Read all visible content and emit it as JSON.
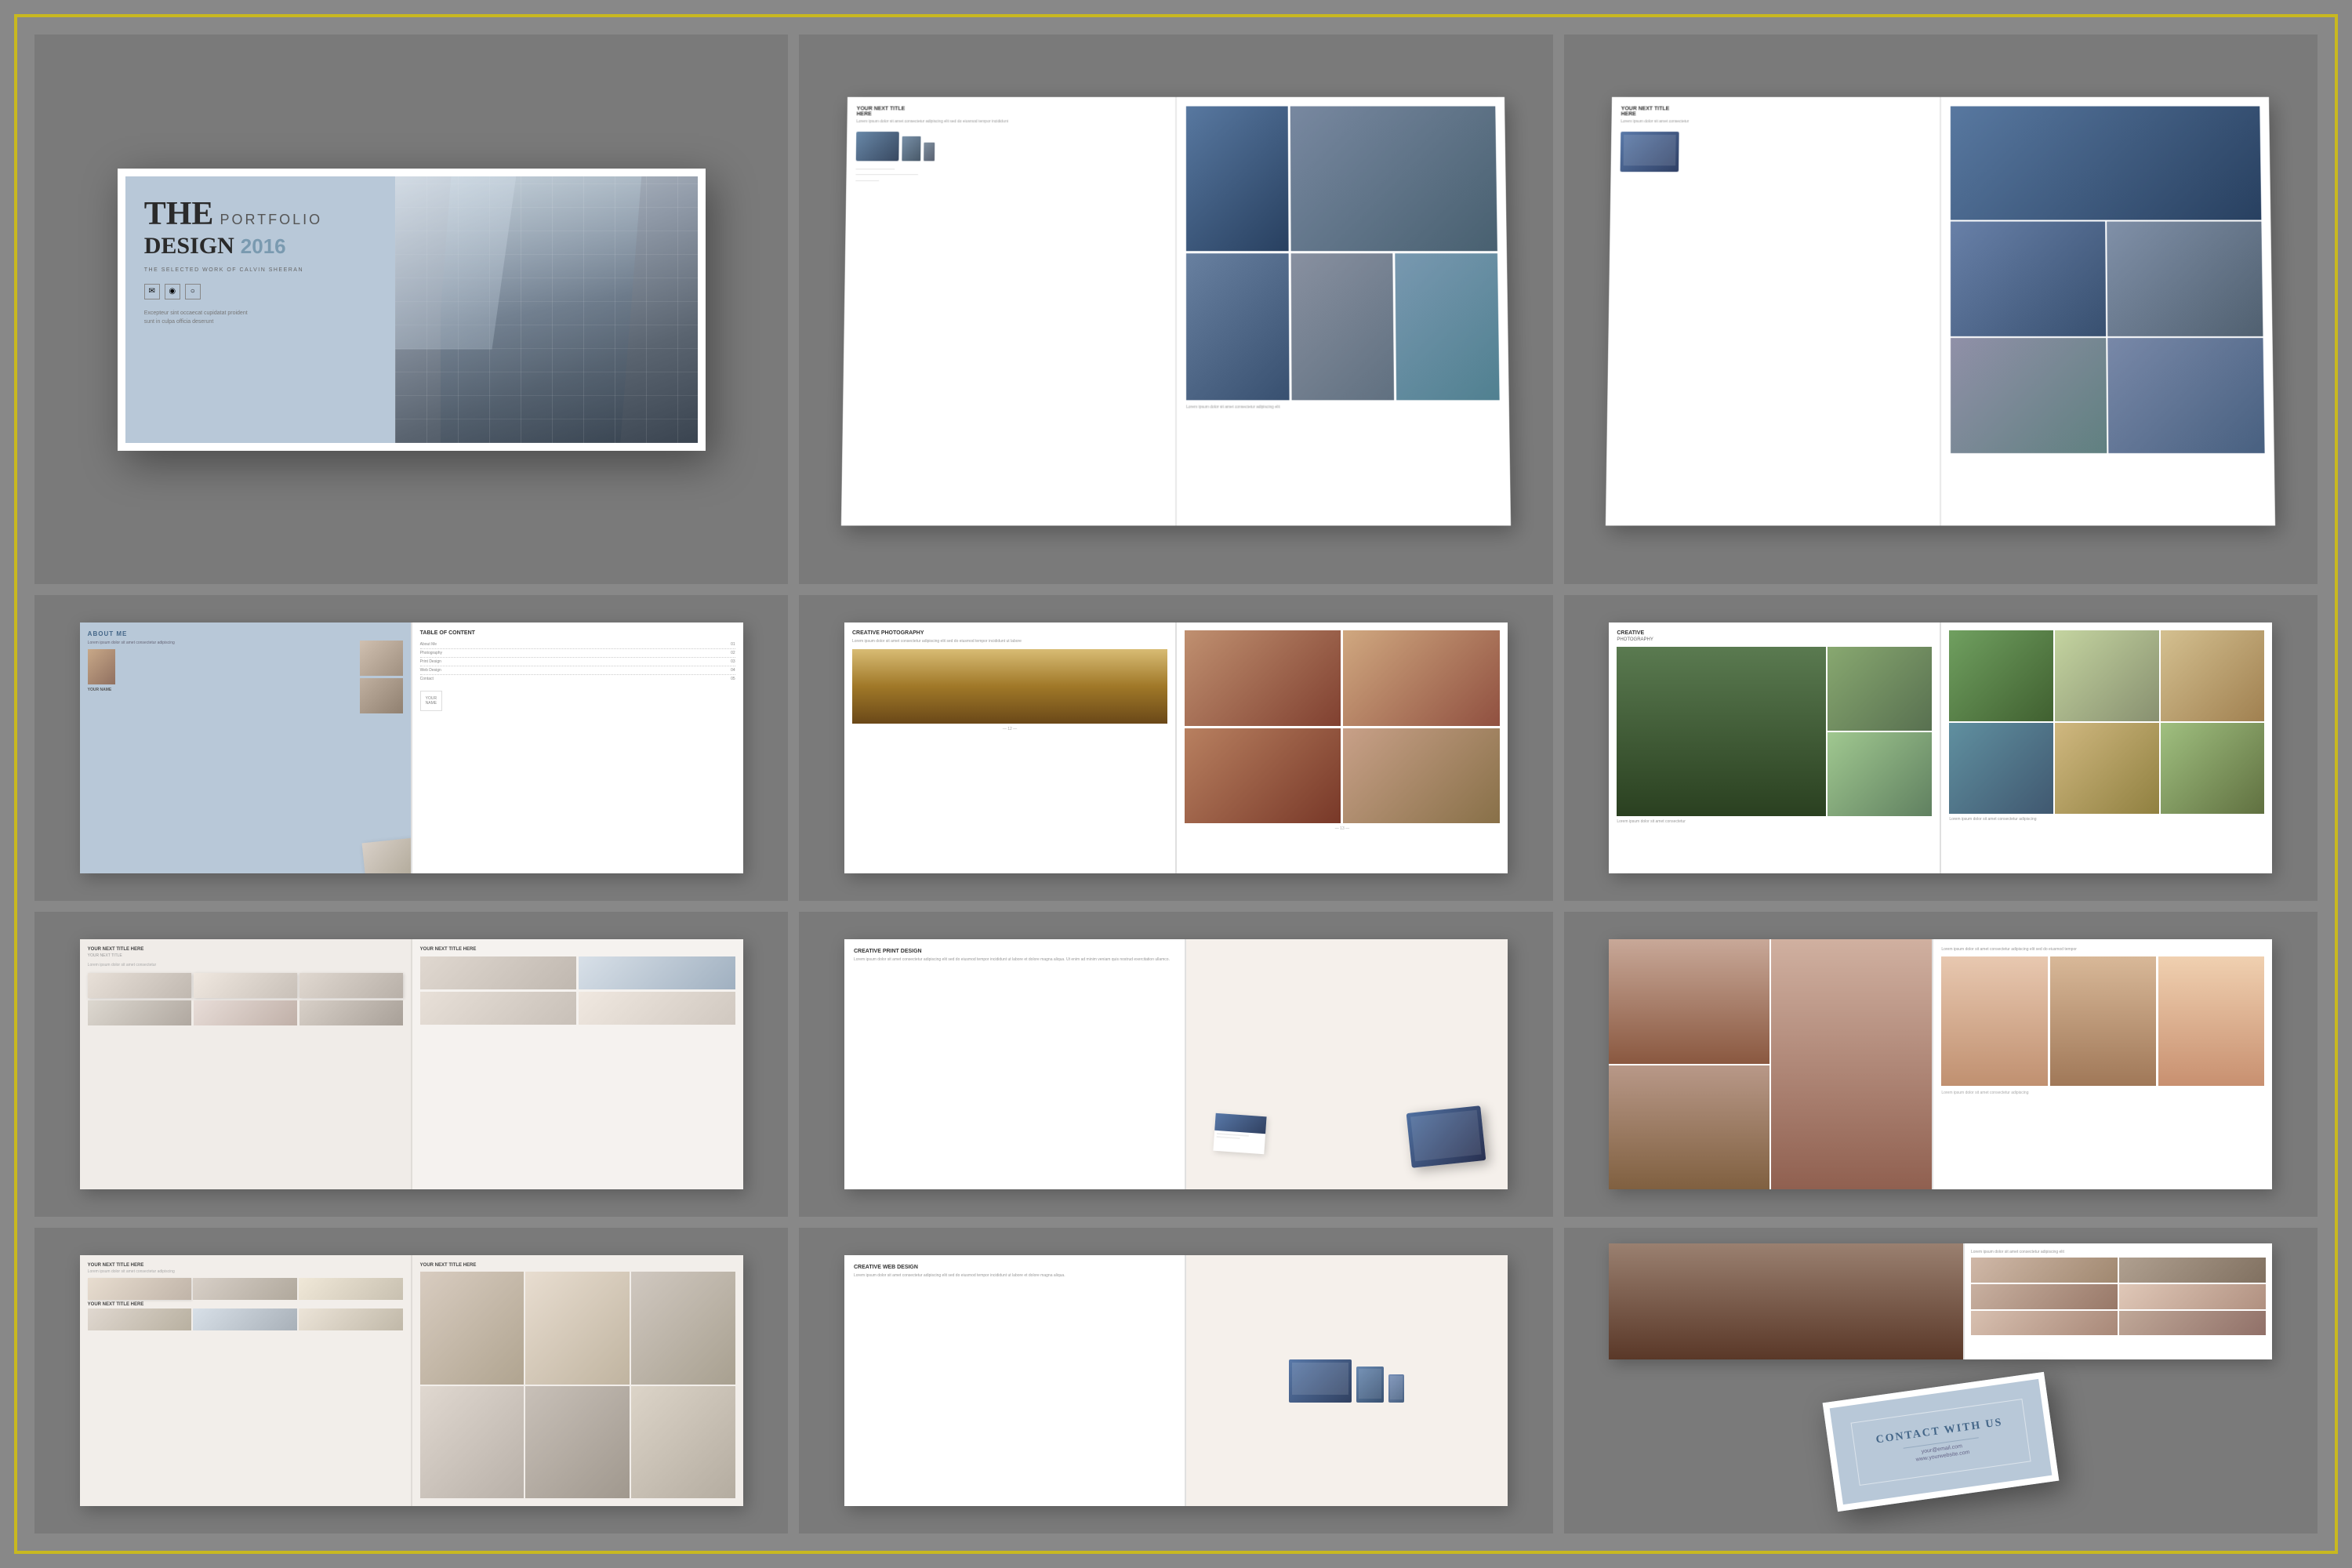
{
  "border_color": "#c8b820",
  "background": "#888888",
  "cells": [
    {
      "id": "hero",
      "type": "hero",
      "title_the": "THE",
      "title_portfolio": "PORTFOLIO",
      "title_design": "DESIGN",
      "title_year": "2016",
      "subtitle": "THE SELECTED WORK OF CALVIN SHEERAN",
      "desc_line1": "Excepteur sint occaecat cupidatat proident",
      "desc_line2": "sunt in culpa officia deserunt"
    },
    {
      "id": "tech-spread",
      "type": "tech",
      "page_title": "YOUR NEXT TITLE HERE",
      "subtitle": "Here"
    },
    {
      "id": "tech-spread-2",
      "type": "tech2",
      "page_title": "YOUR NEXT TITLE HERE"
    },
    {
      "id": "about-toc",
      "type": "about_toc",
      "about_title": "ABOUT ME",
      "toc_title": "TABLE OF CONTENT"
    },
    {
      "id": "photo-landscape",
      "type": "photography",
      "section_title": "CREATIVE PHOTOGRAPHY"
    },
    {
      "id": "photo-grid-right",
      "type": "photo_grid_right",
      "section_title": "CREATIVE PHOTOGRAPHY"
    },
    {
      "id": "print-design",
      "type": "print",
      "section_title": "CREATIVE PRINT DESIGN"
    },
    {
      "id": "fashion-spread",
      "type": "fashion"
    },
    {
      "id": "wedding-spread",
      "type": "wedding"
    },
    {
      "id": "branding-spread",
      "type": "branding",
      "page_title1": "YOUR NEXT TITLE HERE",
      "page_title2": "YOUR NEXT TITLE HERE"
    },
    {
      "id": "web-design",
      "type": "web",
      "section_title": "CREATIVE WEB DESIGN"
    },
    {
      "id": "wedding2",
      "type": "wedding2"
    },
    {
      "id": "contact",
      "type": "contact",
      "title": "CONTACT WITH US",
      "line1": "your@email.com",
      "line2": "www.yourwebsite.com"
    }
  ]
}
